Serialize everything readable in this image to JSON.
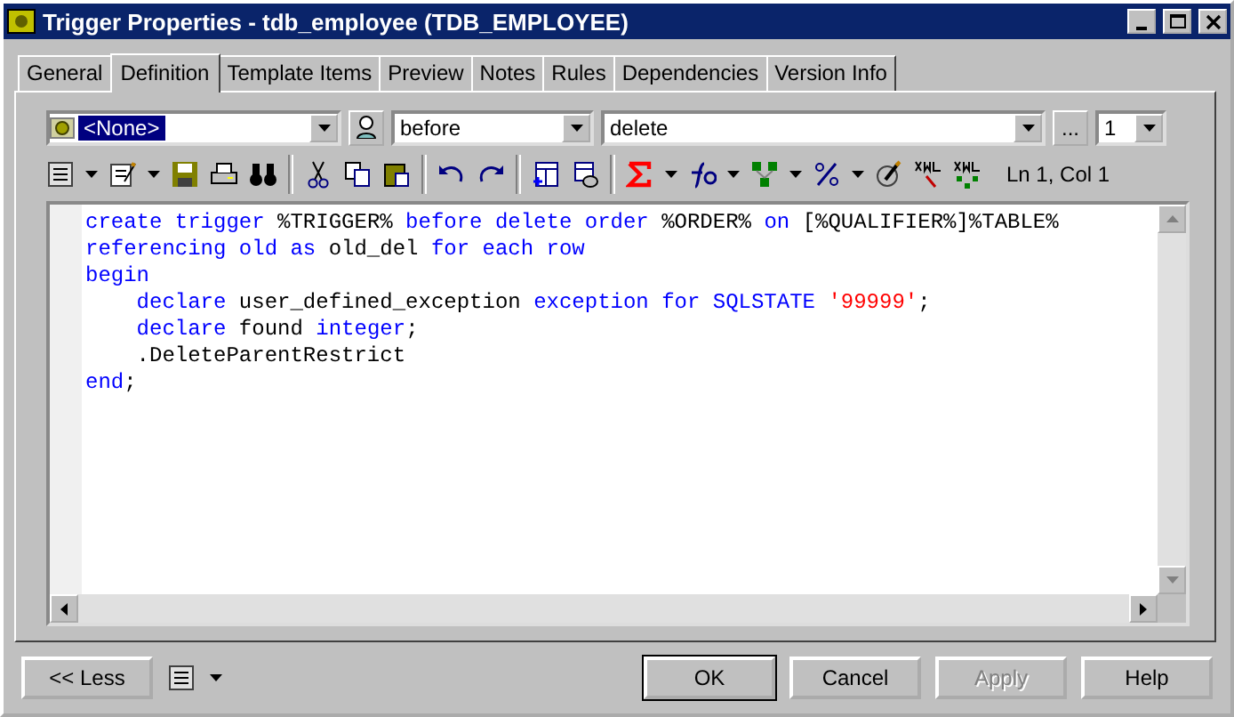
{
  "window": {
    "title": "Trigger Properties - tdb_employee (TDB_EMPLOYEE)"
  },
  "tabs": [
    {
      "label": "General",
      "selected": false
    },
    {
      "label": "Definition",
      "selected": true
    },
    {
      "label": "Template Items",
      "selected": false
    },
    {
      "label": "Preview",
      "selected": false
    },
    {
      "label": "Notes",
      "selected": false
    },
    {
      "label": "Rules",
      "selected": false
    },
    {
      "label": "Dependencies",
      "selected": false
    },
    {
      "label": "Version Info",
      "selected": false
    }
  ],
  "template_select": {
    "value": "<None>"
  },
  "time_select": {
    "value": "before"
  },
  "event_select": {
    "value": "delete"
  },
  "ellipsis_button": "...",
  "order_select": {
    "value": "1"
  },
  "cursor_position": "Ln 1, Col 1",
  "code_lines": [
    [
      {
        "kind": "keyword",
        "text": "create trigger "
      },
      {
        "kind": "plain",
        "text": "%TRIGGER%"
      },
      {
        "kind": "keyword",
        "text": " before delete order "
      },
      {
        "kind": "plain",
        "text": "%ORDER%"
      },
      {
        "kind": "keyword",
        "text": " on "
      },
      {
        "kind": "plain",
        "text": "[%QUALIFIER%]%TABLE%"
      }
    ],
    [
      {
        "kind": "keyword",
        "text": "referencing old as "
      },
      {
        "kind": "plain",
        "text": "old_del"
      },
      {
        "kind": "keyword",
        "text": " for each row"
      }
    ],
    [
      {
        "kind": "keyword",
        "text": "begin"
      }
    ],
    [
      {
        "kind": "keyword",
        "text": "    declare "
      },
      {
        "kind": "plain",
        "text": "user_defined_exception "
      },
      {
        "kind": "keyword",
        "text": "exception for SQLSTATE "
      },
      {
        "kind": "string",
        "text": "'99999'"
      },
      {
        "kind": "plain",
        "text": ";"
      }
    ],
    [
      {
        "kind": "keyword",
        "text": "    declare "
      },
      {
        "kind": "plain",
        "text": "found "
      },
      {
        "kind": "keyword",
        "text": "integer"
      },
      {
        "kind": "plain",
        "text": ";"
      }
    ],
    [
      {
        "kind": "plain",
        "text": "    .DeleteParentRestrict"
      }
    ],
    [
      {
        "kind": "keyword",
        "text": "end"
      },
      {
        "kind": "plain",
        "text": ";"
      }
    ]
  ],
  "buttons_left": [
    {
      "label": "<< Less"
    }
  ],
  "buttons": [
    {
      "label": "OK",
      "disabled": false,
      "default": true
    },
    {
      "label": "Cancel",
      "disabled": false,
      "default": false
    },
    {
      "label": "Apply",
      "disabled": true,
      "default": false
    },
    {
      "label": "Help",
      "disabled": false,
      "default": false
    }
  ]
}
